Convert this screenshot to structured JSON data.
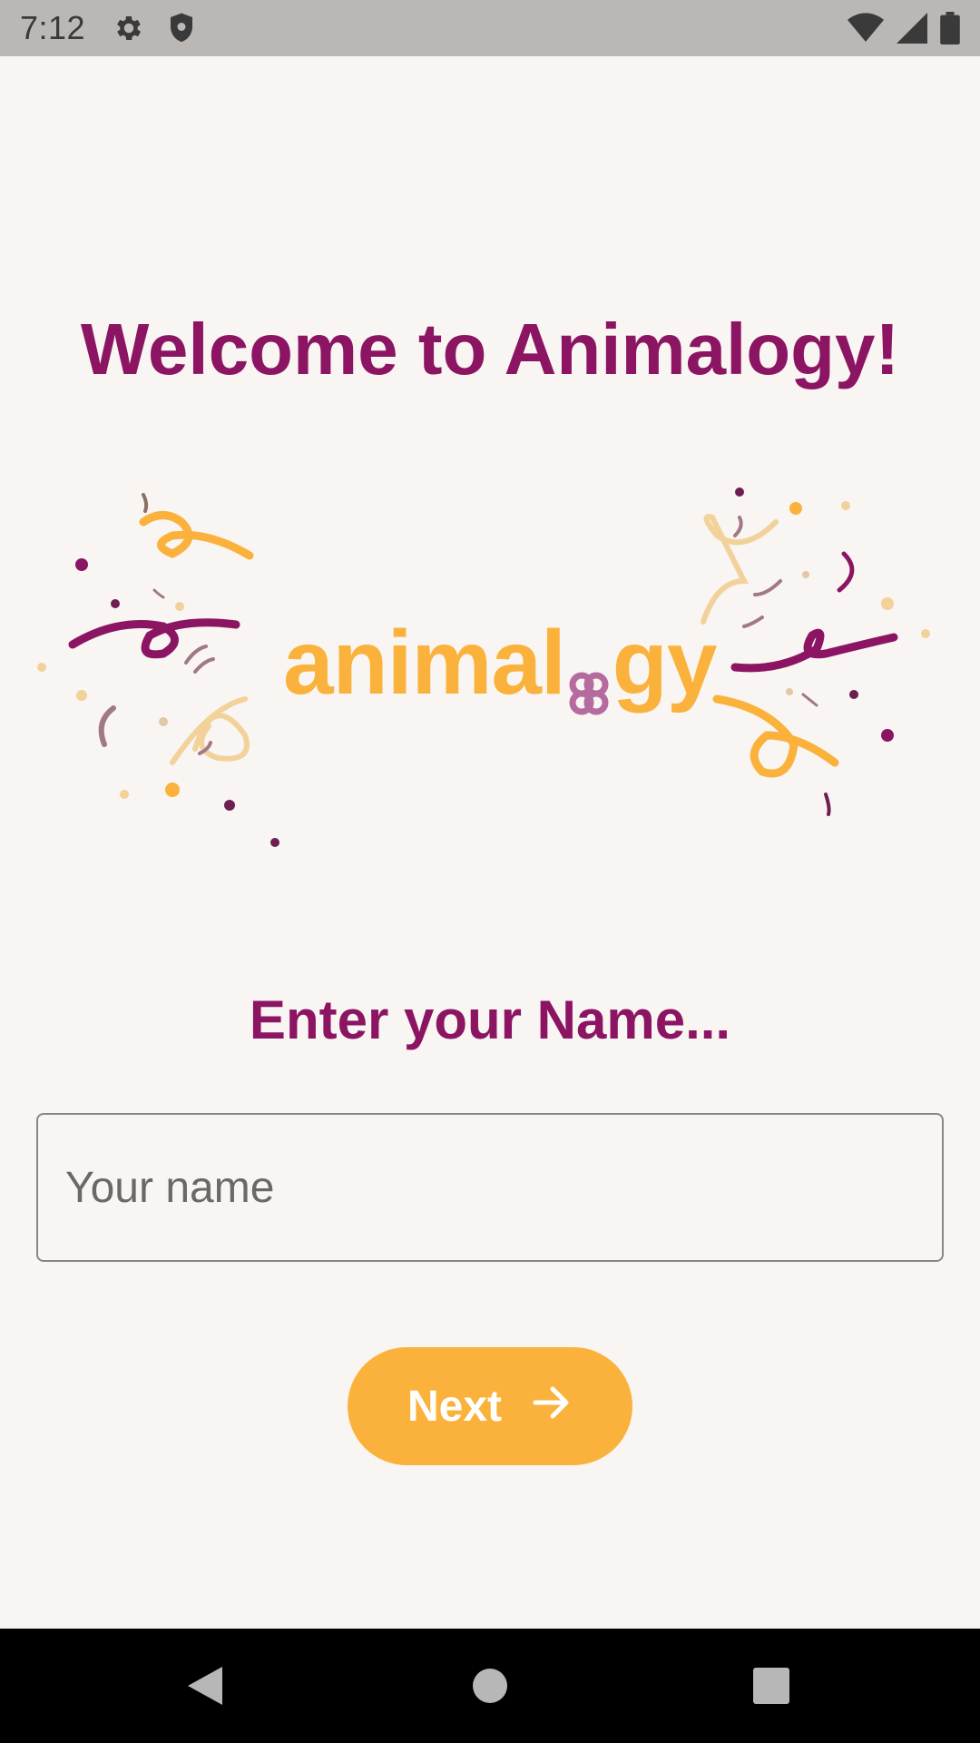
{
  "status_bar": {
    "time": "7:12",
    "icons_left": [
      "gear-icon",
      "shield-icon"
    ],
    "icons_right": [
      "wifi-icon",
      "signal-icon",
      "battery-icon"
    ]
  },
  "welcome": {
    "title": "Welcome to Animalogy!"
  },
  "logo": {
    "text_before": "animal",
    "text_after": "gy",
    "brand_color": "#fbb23c",
    "accent_color": "#8c1563"
  },
  "name_prompt": {
    "label": "Enter your Name...",
    "placeholder": "Your name",
    "value": ""
  },
  "next_button": {
    "label": "Next",
    "icon": "arrow-right-icon",
    "color": "#fbb23c"
  },
  "nav_bar": {
    "buttons": [
      "back-icon",
      "home-icon",
      "recents-icon"
    ]
  },
  "colors": {
    "background": "#f8f5f2",
    "primary_text": "#8c1563",
    "accent": "#fbb23c"
  }
}
